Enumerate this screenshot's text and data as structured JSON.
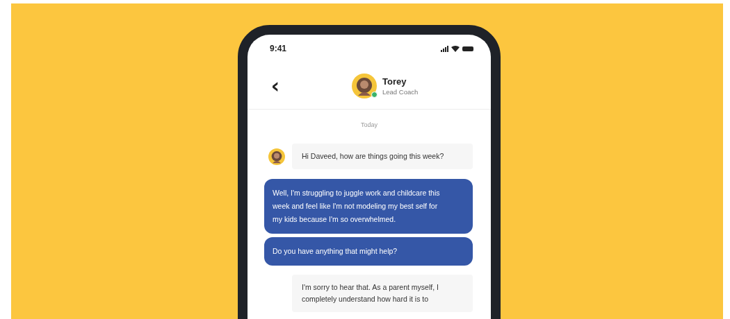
{
  "status_bar": {
    "time": "9:41"
  },
  "header": {
    "back": "‹",
    "name": "Torey",
    "role": "Lead Coach",
    "online": true
  },
  "date_label": "Today",
  "messages": [
    {
      "kind": "incoming",
      "text": "Hi Daveed, how are things going this week?",
      "avatar": true
    },
    {
      "kind": "outgoing",
      "text": "Well, I'm struggling to juggle work and childcare this week and feel like I'm not modeling my best self for my kids because I'm so overwhelmed."
    },
    {
      "kind": "outgoing",
      "text": "Do you have anything that might help?"
    },
    {
      "kind": "incoming",
      "text": "I'm sorry to hear that. As a parent myself, I completely understand how hard it is to",
      "avatar": false
    }
  ]
}
